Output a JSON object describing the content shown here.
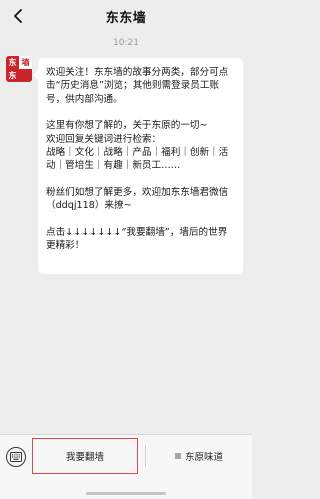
{
  "header": {
    "title": "东东墙",
    "back_icon": "chevron-left-icon"
  },
  "chat": {
    "timestamp": "10:21",
    "avatar": {
      "chars": [
        "东",
        "墙",
        "东",
        ""
      ],
      "color": "#c9252b"
    },
    "message": {
      "p1": "欢迎关注！东东墙的故事分两类，部分可点击“历史消息”浏览；其他则需登录员工账号，供内部沟通。",
      "p2": "这里有你想了解的，关于东原的一切~",
      "p3": "欢迎回复关键词进行检索：",
      "p4": "战略｜文化｜战略｜产品｜福利｜创新｜活动｜管培生｜有趣｜新员工……",
      "p5": "粉丝们如想了解更多，欢迎加东东墙君微信（ddqj118）来撩~",
      "p6": "点击↓↓↓↓↓↓↓“我要翻墙”，墙后的世界更精彩！"
    }
  },
  "bottom_menu": {
    "keyboard_icon": "keyboard-icon",
    "items": [
      {
        "label": "我要翻墙"
      },
      {
        "label": "东原味道",
        "icon": "menu-icon"
      }
    ],
    "highlight_color": "#e14a4a"
  }
}
